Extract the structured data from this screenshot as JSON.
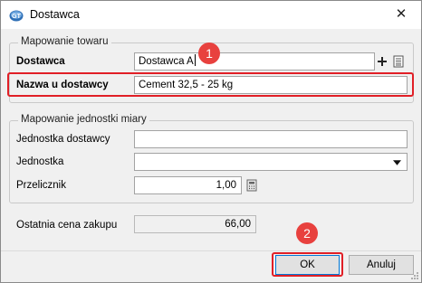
{
  "window": {
    "title": "Dostawca"
  },
  "mapping": {
    "legend": "Mapowanie towaru",
    "supplier_label": "Dostawca",
    "supplier_value": "Dostawca A",
    "name_label": "Nazwa u dostawcy",
    "name_value": "Cement 32,5 - 25 kg"
  },
  "unit_mapping": {
    "legend": "Mapowanie jednostki miary",
    "supplier_unit_label": "Jednostka dostawcy",
    "supplier_unit_value": "",
    "unit_label": "Jednostka",
    "unit_value": "",
    "factor_label": "Przelicznik",
    "factor_value": "1,00"
  },
  "last_price": {
    "label": "Ostatnia cena zakupu",
    "value": "66,00"
  },
  "buttons": {
    "ok": "OK",
    "cancel": "Anuluj"
  },
  "annotations": {
    "marker1": "1",
    "marker2": "2"
  },
  "colors": {
    "highlight": "#e11f26",
    "marker": "#e8413e",
    "accent": "#0078d7"
  },
  "icons": {
    "app": "gt-app-icon",
    "close": "close-icon",
    "add": "plus-icon",
    "list": "list-icon",
    "dropdown": "chevron-down-icon",
    "calculator": "calculator-icon"
  }
}
